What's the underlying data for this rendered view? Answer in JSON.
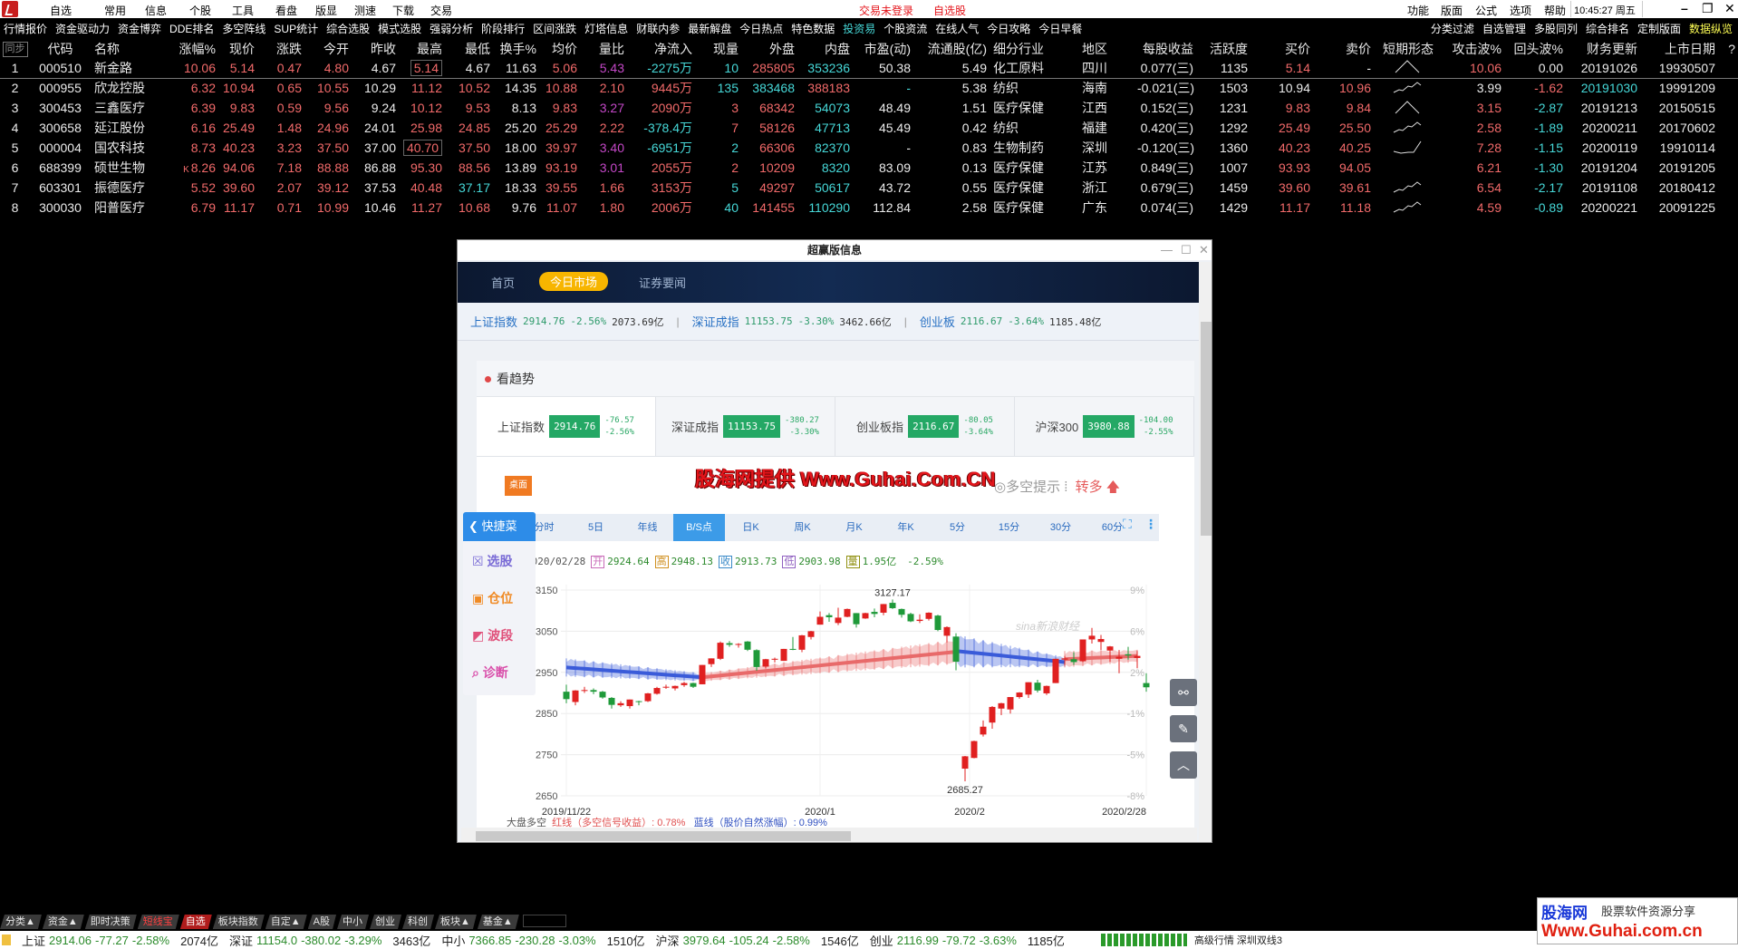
{
  "menu": {
    "items": [
      "自选",
      "常用",
      "信息",
      "个股",
      "工具",
      "看盘",
      "版显",
      "测速",
      "下载",
      "交易"
    ],
    "login_status": "交易未登录",
    "watchlist": "自选股",
    "right_items": [
      "功能",
      "版面",
      "公式",
      "选项",
      "帮助"
    ],
    "time": "10:45:27",
    "weekday": "周五"
  },
  "toolbar": {
    "left": [
      "行情报价",
      "资金驱动力",
      "资金博弈",
      "DDE排名",
      "多空阵线",
      "SUP统计",
      "综合选股",
      "模式选股",
      "强弱分析",
      "阶段排行",
      "区间涨跌",
      "灯塔信息",
      "财联内参",
      "最新解盘",
      "今日热点",
      "特色数据",
      "投资易",
      "个股资流",
      "在线人气",
      "今日攻略",
      "今日早餐"
    ],
    "highlight": "投资易",
    "right": [
      "分类过滤",
      "自选管理",
      "多股同列",
      "综合排名",
      "定制版面",
      "数据纵览"
    ]
  },
  "table": {
    "sync": "同步",
    "headers": [
      "",
      "代码",
      "名称",
      "涨幅%",
      "现价",
      "涨跌",
      "今开",
      "昨收",
      "最高",
      "最低",
      "换手%",
      "均价",
      "量比",
      "净流入",
      "现量",
      "外盘",
      "内盘",
      "市盈(动)",
      "流通股(亿)",
      "细分行业",
      "地区",
      "每股收益",
      "活跃度",
      "买价",
      "卖价",
      "短期形态",
      "攻击波%",
      "回头波%",
      "财务更新",
      "上市日期",
      "?"
    ],
    "rows": [
      {
        "cells": [
          "1",
          "000510",
          "新金路",
          "10.06",
          "5.14",
          "0.47",
          "4.80",
          "4.67",
          "5.14",
          "4.67",
          "11.63",
          "5.06",
          "5.43",
          "-2275万",
          "10",
          "285805",
          "353236",
          "50.38",
          "5.49",
          "化工原料",
          "四川",
          "0.077(三)",
          "1135",
          "5.14",
          "-",
          "",
          "10.06",
          "0.00",
          "20191026",
          "19930507"
        ],
        "colors": "wwwrrrrwrwwrmccrcwwwwwwrwwrwww",
        "shape": "peak",
        "marker": "",
        "boxed": true
      },
      {
        "cells": [
          "2",
          "000955",
          "欣龙控股",
          "6.32",
          "10.94",
          "0.65",
          "10.55",
          "10.29",
          "11.12",
          "10.52",
          "14.35",
          "10.88",
          "2.10",
          "9445万",
          "135",
          "383468",
          "388183",
          "-",
          "5.38",
          "纺织",
          "海南",
          "-0.021(三)",
          "1503",
          "10.94",
          "10.96",
          "",
          "3.99",
          "-1.62",
          "20191030",
          "19991209"
        ],
        "colors": "wwwrrrrwrrwrrrccrcwwwwwwrrwrcww",
        "shape": "uptrend",
        "marker": "",
        "boxed": false
      },
      {
        "cells": [
          "3",
          "300453",
          "三鑫医疗",
          "6.39",
          "9.83",
          "0.59",
          "9.56",
          "9.24",
          "10.12",
          "9.53",
          "8.13",
          "9.83",
          "3.27",
          "2090万",
          "3",
          "68342",
          "54073",
          "48.49",
          "1.51",
          "医疗保健",
          "江西",
          "0.152(三)",
          "1231",
          "9.83",
          "9.84",
          "",
          "3.15",
          "-2.87",
          "20191213",
          "20150515"
        ],
        "colors": "wwwrrrrwrrwrmrrrcwwwwwwrrwrcww",
        "shape": "peak",
        "marker": "",
        "boxed": false
      },
      {
        "cells": [
          "4",
          "300658",
          "延江股份",
          "6.16",
          "25.49",
          "1.48",
          "24.96",
          "24.01",
          "25.98",
          "24.85",
          "25.20",
          "25.29",
          "2.22",
          "-378.4万",
          "7",
          "58126",
          "47713",
          "45.49",
          "0.42",
          "纺织",
          "福建",
          "0.420(三)",
          "1292",
          "25.49",
          "25.50",
          "",
          "2.58",
          "-1.89",
          "20200211",
          "20170602"
        ],
        "colors": "wwwrrrrwrrwrrcrrcwwwwwwrrwrcww",
        "shape": "uptrend",
        "marker": "",
        "boxed": false
      },
      {
        "cells": [
          "5",
          "000004",
          "国农科技",
          "8.73",
          "40.23",
          "3.23",
          "37.50",
          "37.00",
          "40.70",
          "37.50",
          "18.00",
          "39.97",
          "3.40",
          "-6951万",
          "2",
          "66306",
          "82370",
          "-",
          "0.83",
          "生物制药",
          "深圳",
          "-0.120(三)",
          "1360",
          "40.23",
          "40.25",
          "",
          "7.28",
          "-1.15",
          "20200119",
          "19910114"
        ],
        "colors": "wwwrrrrwrrwrmccrcwwwwwwrrwrcww",
        "shape": "dip-rise",
        "marker": "",
        "boxed": true
      },
      {
        "cells": [
          "6",
          "688399",
          "硕世生物",
          "8.26",
          "94.06",
          "7.18",
          "88.88",
          "86.88",
          "95.30",
          "88.56",
          "13.89",
          "93.19",
          "3.01",
          "2055万",
          "2",
          "10209",
          "8320",
          "83.09",
          "0.13",
          "医疗保健",
          "江苏",
          "0.849(三)",
          "1007",
          "93.93",
          "94.05",
          "",
          "6.21",
          "-1.30",
          "20191204",
          "20191205"
        ],
        "colors": "wwwrrrrwrrwrmrrrcwwwwwwrrwrcww",
        "shape": "",
        "marker": "K",
        "boxed": false
      },
      {
        "cells": [
          "7",
          "603301",
          "振德医疗",
          "5.52",
          "39.60",
          "2.07",
          "39.12",
          "37.53",
          "40.48",
          "37.17",
          "18.33",
          "39.55",
          "1.66",
          "3153万",
          "5",
          "49297",
          "50617",
          "43.72",
          "0.55",
          "医疗保健",
          "浙江",
          "0.679(三)",
          "1459",
          "39.60",
          "39.61",
          "",
          "6.54",
          "-2.17",
          "20191108",
          "20180412"
        ],
        "colors": "wwwrrrrwrcwrrrcrcwwwwwwrrwrcww",
        "shape": "uptrend",
        "marker": "",
        "boxed": false
      },
      {
        "cells": [
          "8",
          "300030",
          "阳普医疗",
          "6.79",
          "11.17",
          "0.71",
          "10.99",
          "10.46",
          "11.27",
          "10.68",
          "9.76",
          "11.07",
          "1.80",
          "2006万",
          "40",
          "141455",
          "110290",
          "112.84",
          "2.58",
          "医疗保健",
          "广东",
          "0.074(三)",
          "1429",
          "11.17",
          "11.18",
          "",
          "4.59",
          "-0.89",
          "20200221",
          "20091225"
        ],
        "colors": "wwwrrrrwrrwrrrcrcwwwwwwrrwrcww",
        "shape": "uptrend",
        "marker": "",
        "boxed": false
      }
    ]
  },
  "popup": {
    "title": "超赢版信息",
    "nav": [
      "首页",
      "今日市场",
      "证券要闻"
    ],
    "nav_active": "今日市场",
    "index_line": [
      {
        "name": "上证指数",
        "value": "2914.76",
        "pct": "-2.56%",
        "amount": "2073.69亿"
      },
      {
        "name": "深证成指",
        "value": "11153.75",
        "pct": "-3.30%",
        "amount": "3462.66亿"
      },
      {
        "name": "创业板",
        "value": "2116.67",
        "pct": "-3.64%",
        "amount": "1185.48亿"
      }
    ],
    "section_title": "看趋势",
    "cards": [
      {
        "name": "上证指数",
        "value": "2914.76",
        "chg": "-76.57",
        "pct": "-2.56%"
      },
      {
        "name": "深证成指",
        "value": "11153.75",
        "chg": "-380.27",
        "pct": "-3.30%"
      },
      {
        "name": "创业板指",
        "value": "2116.67",
        "chg": "-80.05",
        "pct": "-3.64%"
      },
      {
        "name": "沪深300",
        "value": "3980.88",
        "chg": "-104.00",
        "pct": "-2.55%"
      }
    ],
    "watermark": "股海网提供 Www.Guhai.Com.CN",
    "hint": "多空提示",
    "turn": "转多",
    "desk": "桌面",
    "quick_label": "快捷菜",
    "quick_items": [
      {
        "label": "选股",
        "color": "#7a6bd6"
      },
      {
        "label": "仓位",
        "color": "#f08a24"
      },
      {
        "label": "波段",
        "color": "#e0507a"
      },
      {
        "label": "诊断",
        "color": "#d94faa"
      }
    ],
    "tabs": [
      "分时",
      "5日",
      "年线",
      "B/S点",
      "日K",
      "周K",
      "月K",
      "年K",
      "5分",
      "15分",
      "30分",
      "60分"
    ],
    "tab_active": "B/S点",
    "ohlc": {
      "date": "2020/02/28",
      "open_label": "开",
      "open": "2924.64",
      "high_label": "高",
      "high": "2948.13",
      "close_label": "收",
      "close": "2913.73",
      "low_label": "低",
      "low": "2903.98",
      "vol_label": "量",
      "vol": "1.95亿",
      "pct": "-2.59%"
    },
    "legend": {
      "prefix": "大盘多空",
      "red": "红线（多空信号收益）: 0.78%",
      "blue": "蓝线（股价自然涨幅）: 0.99%"
    },
    "sina": "sina新浪财经"
  },
  "chart_data": {
    "type": "candlestick",
    "ylim": [
      2650,
      3150
    ],
    "yticks": [
      3150,
      3050,
      2950,
      2850,
      2750,
      2650
    ],
    "right_ticks": [
      "9%",
      "6%",
      "2%",
      "-1%",
      "-5%",
      "-8%"
    ],
    "xticks": [
      {
        "index": 0,
        "label": "2019/11/22"
      },
      {
        "index": 28,
        "label": "2020/1"
      },
      {
        "index": 44.5,
        "label": "2020/2"
      },
      {
        "index": 64,
        "label": "2020/2/28"
      }
    ],
    "annotations": [
      {
        "index": 36,
        "label": "3127.17",
        "price": 3127.17
      },
      {
        "index": 44,
        "label": "2685.27",
        "price": 2685.27
      }
    ],
    "up_color": "#e02020",
    "down_color": "#1f9a3a",
    "candles": [
      [
        2903,
        2920,
        2875,
        2885
      ],
      [
        2878,
        2907,
        2870,
        2906
      ],
      [
        2907,
        2915,
        2900,
        2907
      ],
      [
        2907,
        2911,
        2897,
        2903
      ],
      [
        2903,
        2905,
        2886,
        2889
      ],
      [
        2888,
        2890,
        2862,
        2871
      ],
      [
        2870,
        2880,
        2866,
        2875
      ],
      [
        2868,
        2884,
        2862,
        2884
      ],
      [
        2880,
        2881,
        2870,
        2878
      ],
      [
        2880,
        2900,
        2878,
        2899
      ],
      [
        2898,
        2915,
        2896,
        2912
      ],
      [
        2914,
        2920,
        2910,
        2915
      ],
      [
        2911,
        2918,
        2906,
        2917
      ],
      [
        2919,
        2927,
        2915,
        2924
      ],
      [
        2924,
        2925,
        2912,
        2915
      ],
      [
        2921,
        2968,
        2921,
        2968
      ],
      [
        2970,
        2984,
        2963,
        2984
      ],
      [
        2983,
        3025,
        2980,
        3022
      ],
      [
        3021,
        3026,
        3012,
        3017
      ],
      [
        3017,
        3021,
        3010,
        3019
      ],
      [
        3025,
        3026,
        3002,
        3005
      ],
      [
        3004,
        3006,
        2954,
        2963
      ],
      [
        2964,
        2983,
        2960,
        2982
      ],
      [
        2981,
        2986,
        2974,
        2983
      ],
      [
        2978,
        3007,
        2978,
        3007
      ],
      [
        3007,
        3036,
        3004,
        3005
      ],
      [
        3005,
        3041,
        2999,
        3040
      ],
      [
        3036,
        3051,
        3030,
        3050
      ],
      [
        3066,
        3098,
        3066,
        3085
      ],
      [
        3089,
        3094,
        3073,
        3084
      ],
      [
        3070,
        3107,
        3065,
        3083
      ],
      [
        3085,
        3105,
        3084,
        3104
      ],
      [
        3094,
        3094,
        3059,
        3067
      ],
      [
        3081,
        3095,
        3080,
        3094
      ],
      [
        3097,
        3105,
        3084,
        3092
      ],
      [
        3095,
        3116,
        3089,
        3116
      ],
      [
        3119,
        3127.17,
        3104,
        3106
      ],
      [
        3104,
        3105,
        3083,
        3090
      ],
      [
        3092,
        3095,
        3072,
        3074
      ],
      [
        3075,
        3091,
        3070,
        3078
      ],
      [
        3080,
        3096,
        3076,
        3095
      ],
      [
        3088,
        3090,
        3050,
        3053
      ],
      [
        3039,
        3062,
        3023,
        3060
      ],
      [
        3037,
        3045,
        2955,
        2976
      ],
      [
        2716,
        2747,
        2685.27,
        2746
      ],
      [
        2742,
        2784,
        2741,
        2783
      ],
      [
        2799,
        2833,
        2794,
        2818
      ],
      [
        2828,
        2868,
        2813,
        2866
      ],
      [
        2862,
        2876,
        2846,
        2875
      ],
      [
        2860,
        2890,
        2850,
        2890
      ],
      [
        2890,
        2902,
        2886,
        2901
      ],
      [
        2896,
        2926,
        2888,
        2926
      ],
      [
        2925,
        2932,
        2901,
        2906
      ],
      [
        2899,
        2918,
        2895,
        2917
      ],
      [
        2924,
        2983,
        2924,
        2983
      ],
      [
        2981,
        2990,
        2966,
        2984
      ],
      [
        2982,
        2999,
        2968,
        2975
      ],
      [
        2977,
        3030,
        2975,
        3030
      ],
      [
        3030,
        3058,
        3020,
        3039
      ],
      [
        3024,
        3041,
        3004,
        3031
      ],
      [
        3003,
        3014,
        2976,
        3013
      ],
      [
        2983,
        3004,
        2948,
        2988
      ],
      [
        2994,
        3012,
        2981,
        2991
      ],
      [
        2985,
        3002,
        2960,
        2990
      ],
      [
        2924,
        2948,
        2903,
        2913.73
      ]
    ],
    "bands": [
      {
        "color": "#3a5bd9",
        "start": 0,
        "end": 15,
        "from": 2962,
        "to": 2938,
        "spread": [
          22,
          10
        ]
      },
      {
        "color": "#e86a6a",
        "start": 15,
        "end": 43,
        "from": 2938,
        "to": 3000,
        "spread": [
          10,
          30
        ]
      },
      {
        "color": "#3a5bd9",
        "start": 43,
        "end": 55,
        "from": 3002,
        "to": 2975,
        "spread": [
          40,
          12
        ]
      },
      {
        "color": "#e86a6a",
        "start": 55,
        "end": 63,
        "from": 2982,
        "to": 2990,
        "spread": [
          20,
          15
        ]
      }
    ]
  },
  "bottom": {
    "tabs": [
      "分类▲",
      "资金▲",
      "即时决策",
      "短线宝",
      "自选",
      "板块指数",
      "自定▲",
      "A股",
      "中小",
      "创业",
      "科创",
      "板块▲",
      "基金▲"
    ],
    "tab_active": "自选",
    "tab_special": "短线宝",
    "status": [
      {
        "name": "上证",
        "value": "2914.06",
        "chg": "-77.27",
        "pct": "-2.58%",
        "amount": "2074亿"
      },
      {
        "name": "深证",
        "value": "11154.0",
        "chg": "-380.02",
        "pct": "-3.29%",
        "amount": "3463亿"
      },
      {
        "name": "中小",
        "value": "7366.85",
        "chg": "-230.28",
        "pct": "-3.03%",
        "amount": "1510亿"
      },
      {
        "name": "沪深",
        "value": "3979.64",
        "chg": "-105.24",
        "pct": "-2.58%",
        "amount": "1546亿"
      },
      {
        "name": "创业",
        "value": "2116.99",
        "chg": "-79.72",
        "pct": "-3.63%",
        "amount": "1185亿"
      }
    ],
    "feed": "高级行情 深圳双线3",
    "logo": {
      "brand": "股海网",
      "tagline": "股票软件资源分享",
      "url": "Www.Guhai.com.cn"
    }
  }
}
